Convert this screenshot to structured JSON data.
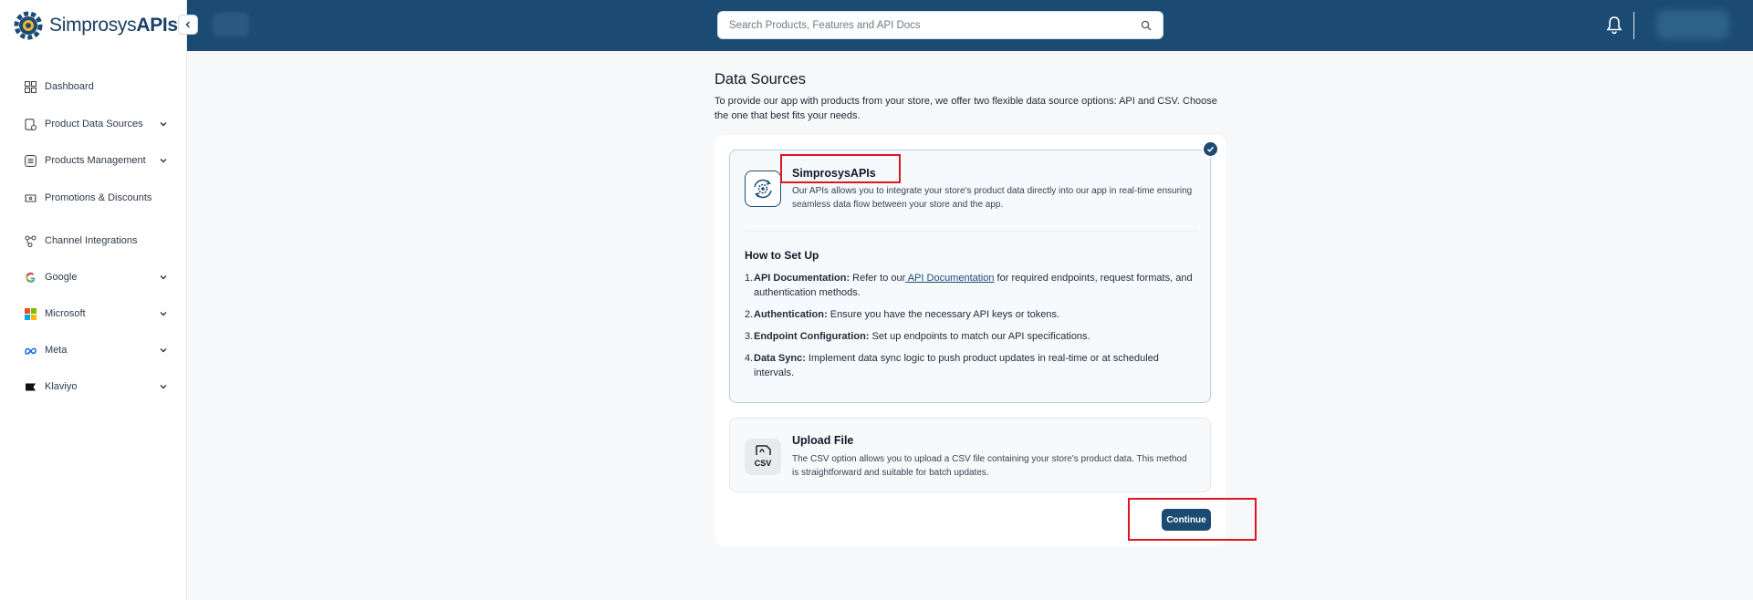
{
  "brand": {
    "name_regular": "Simprosys",
    "name_bold": "APIs"
  },
  "sidebar": {
    "items": [
      {
        "label": "Dashboard",
        "icon": "grid-icon",
        "has_chevron": false
      },
      {
        "label": "Product Data Sources",
        "icon": "data-source-icon",
        "has_chevron": true
      },
      {
        "label": "Products Management",
        "icon": "list-box-icon",
        "has_chevron": true
      },
      {
        "label": "Promotions & Discounts",
        "icon": "ticket-icon",
        "has_chevron": false
      },
      {
        "label": "Channel Integrations",
        "icon": "integration-icon",
        "has_chevron": false
      },
      {
        "label": "Google",
        "icon": "google-icon",
        "has_chevron": true
      },
      {
        "label": "Microsoft",
        "icon": "microsoft-icon",
        "has_chevron": true
      },
      {
        "label": "Meta",
        "icon": "meta-icon",
        "has_chevron": true
      },
      {
        "label": "Klaviyo",
        "icon": "klaviyo-icon",
        "has_chevron": true
      }
    ]
  },
  "header": {
    "search_placeholder": "Search Products, Features and API Docs"
  },
  "main": {
    "title": "Data Sources",
    "description": "To provide our app with products from your store, we offer two flexible data source options: API and CSV. Choose the one that best fits your needs.",
    "options": [
      {
        "title": "SimprosysAPIs",
        "description": "Our APIs allows you to integrate your store's product data directly into our app in real-time ensuring seamless data flow between your store and the app.",
        "selected": true
      },
      {
        "title": "Upload File",
        "icon_text": "CSV",
        "description": "The CSV option allows you to upload a CSV file containing your store's product data. This method is straightforward and suitable for batch updates.",
        "selected": false
      }
    ],
    "howto": {
      "title": "How to Set Up",
      "steps": [
        {
          "num": "1.",
          "bold": "API Documentation:",
          "pre": " Refer to our",
          "link": " API Documentation",
          "post": " for required endpoints, request formats, and authentication methods."
        },
        {
          "num": "2.",
          "bold": "Authentication:",
          "text": " Ensure you have the necessary API keys or tokens."
        },
        {
          "num": "3.",
          "bold": "Endpoint Configuration:",
          "text": " Set up endpoints to match our API specifications."
        },
        {
          "num": "4.",
          "bold": "Data Sync:",
          "text": " Implement data sync logic to push product updates in real-time or at scheduled intervals."
        }
      ]
    },
    "continue_label": "Continue"
  },
  "colors": {
    "primary": "#1b4b73",
    "highlight": "#e0161c"
  }
}
